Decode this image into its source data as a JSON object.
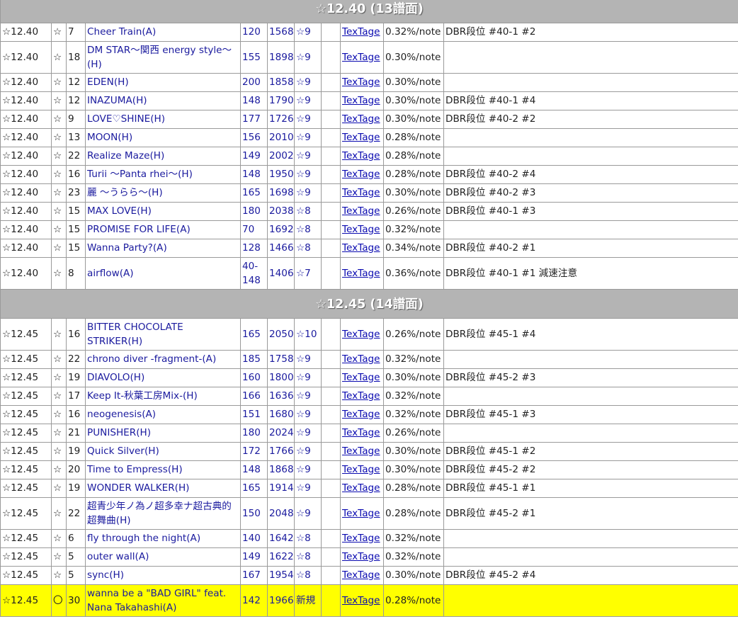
{
  "sections": [
    {
      "header": "☆12.40 (13譜面)",
      "rows": [
        {
          "level": "☆12.40",
          "mark": "☆",
          "ver": "7",
          "title": "Cheer Train(A)",
          "bpm": "120",
          "notes": "1568",
          "sran": "☆9",
          "link": "TexTage",
          "rate": "0.32%/note",
          "note": "DBR段位 #40-1 #2"
        },
        {
          "level": "☆12.40",
          "mark": "☆",
          "ver": "18",
          "title": "DM STAR〜関西 energy style〜(H)",
          "bpm": "155",
          "notes": "1898",
          "sran": "☆9",
          "link": "TexTage",
          "rate": "0.30%/note",
          "note": "",
          "wrap": true
        },
        {
          "level": "☆12.40",
          "mark": "☆",
          "ver": "12",
          "title": "EDEN(H)",
          "bpm": "200",
          "notes": "1858",
          "sran": "☆9",
          "link": "TexTage",
          "rate": "0.30%/note",
          "note": ""
        },
        {
          "level": "☆12.40",
          "mark": "☆",
          "ver": "12",
          "title": "INAZUMA(H)",
          "bpm": "148",
          "notes": "1790",
          "sran": "☆9",
          "link": "TexTage",
          "rate": "0.30%/note",
          "note": "DBR段位 #40-1 #4"
        },
        {
          "level": "☆12.40",
          "mark": "☆",
          "ver": "9",
          "title": "LOVE♡SHINE(H)",
          "bpm": "177",
          "notes": "1726",
          "sran": "☆9",
          "link": "TexTage",
          "rate": "0.30%/note",
          "note": "DBR段位 #40-2 #2"
        },
        {
          "level": "☆12.40",
          "mark": "☆",
          "ver": "13",
          "title": "MOON(H)",
          "bpm": "156",
          "notes": "2010",
          "sran": "☆9",
          "link": "TexTage",
          "rate": "0.28%/note",
          "note": ""
        },
        {
          "level": "☆12.40",
          "mark": "☆",
          "ver": "22",
          "title": "Realize Maze(H)",
          "bpm": "149",
          "notes": "2002",
          "sran": "☆9",
          "link": "TexTage",
          "rate": "0.28%/note",
          "note": ""
        },
        {
          "level": "☆12.40",
          "mark": "☆",
          "ver": "16",
          "title": "Turii 〜Panta rhei〜(H)",
          "bpm": "148",
          "notes": "1950",
          "sran": "☆9",
          "link": "TexTage",
          "rate": "0.28%/note",
          "note": "DBR段位 #40-2 #4"
        },
        {
          "level": "☆12.40",
          "mark": "☆",
          "ver": "23",
          "title": "麗 〜うらら〜(H)",
          "bpm": "165",
          "notes": "1698",
          "sran": "☆9",
          "link": "TexTage",
          "rate": "0.30%/note",
          "note": "DBR段位 #40-2 #3"
        },
        {
          "level": "☆12.40",
          "mark": "☆",
          "ver": "15",
          "title": "MAX LOVE(H)",
          "bpm": "180",
          "notes": "2038",
          "sran": "☆8",
          "link": "TexTage",
          "rate": "0.26%/note",
          "note": "DBR段位 #40-1 #3"
        },
        {
          "level": "☆12.40",
          "mark": "☆",
          "ver": "15",
          "title": "PROMISE FOR LIFE(A)",
          "bpm": "70",
          "notes": "1692",
          "sran": "☆8",
          "link": "TexTage",
          "rate": "0.32%/note",
          "note": ""
        },
        {
          "level": "☆12.40",
          "mark": "☆",
          "ver": "15",
          "title": "Wanna Party?(A)",
          "bpm": "128",
          "notes": "1466",
          "sran": "☆8",
          "link": "TexTage",
          "rate": "0.34%/note",
          "note": "DBR段位 #40-2 #1"
        },
        {
          "level": "☆12.40",
          "mark": "☆",
          "ver": "8",
          "title": "airflow(A)",
          "bpm": "40-148",
          "notes": "1406",
          "sran": "☆7",
          "link": "TexTage",
          "rate": "0.36%/note",
          "note": "DBR段位 #40-1 #1 減速注意",
          "wrap": true
        }
      ]
    },
    {
      "header": "☆12.45 (14譜面)",
      "rows": [
        {
          "level": "☆12.45",
          "mark": "☆",
          "ver": "16",
          "title": "BITTER CHOCOLATE STRIKER(H)",
          "bpm": "165",
          "notes": "2050",
          "sran": "☆10",
          "link": "TexTage",
          "rate": "0.26%/note",
          "note": "DBR段位 #45-1 #4",
          "wrap": true
        },
        {
          "level": "☆12.45",
          "mark": "☆",
          "ver": "22",
          "title": "chrono diver -fragment-(A)",
          "bpm": "185",
          "notes": "1758",
          "sran": "☆9",
          "link": "TexTage",
          "rate": "0.32%/note",
          "note": ""
        },
        {
          "level": "☆12.45",
          "mark": "☆",
          "ver": "19",
          "title": "DIAVOLO(H)",
          "bpm": "160",
          "notes": "1800",
          "sran": "☆9",
          "link": "TexTage",
          "rate": "0.30%/note",
          "note": "DBR段位 #45-2 #3"
        },
        {
          "level": "☆12.45",
          "mark": "☆",
          "ver": "17",
          "title": "Keep It-秋葉工房Mix-(H)",
          "bpm": "166",
          "notes": "1636",
          "sran": "☆9",
          "link": "TexTage",
          "rate": "0.32%/note",
          "note": ""
        },
        {
          "level": "☆12.45",
          "mark": "☆",
          "ver": "16",
          "title": "neogenesis(A)",
          "bpm": "151",
          "notes": "1680",
          "sran": "☆9",
          "link": "TexTage",
          "rate": "0.32%/note",
          "note": "DBR段位 #45-1 #3"
        },
        {
          "level": "☆12.45",
          "mark": "☆",
          "ver": "21",
          "title": "PUNISHER(H)",
          "bpm": "180",
          "notes": "2024",
          "sran": "☆9",
          "link": "TexTage",
          "rate": "0.26%/note",
          "note": ""
        },
        {
          "level": "☆12.45",
          "mark": "☆",
          "ver": "19",
          "title": "Quick Silver(H)",
          "bpm": "172",
          "notes": "1766",
          "sran": "☆9",
          "link": "TexTage",
          "rate": "0.30%/note",
          "note": "DBR段位 #45-1 #2"
        },
        {
          "level": "☆12.45",
          "mark": "☆",
          "ver": "20",
          "title": "Time to Empress(H)",
          "bpm": "148",
          "notes": "1868",
          "sran": "☆9",
          "link": "TexTage",
          "rate": "0.30%/note",
          "note": "DBR段位 #45-2 #2"
        },
        {
          "level": "☆12.45",
          "mark": "☆",
          "ver": "19",
          "title": "WONDER WALKER(H)",
          "bpm": "165",
          "notes": "1914",
          "sran": "☆9",
          "link": "TexTage",
          "rate": "0.28%/note",
          "note": "DBR段位 #45-1 #1"
        },
        {
          "level": "☆12.45",
          "mark": "☆",
          "ver": "22",
          "title": "超青少年ノ為ノ超多幸ナ超古典的超舞曲(H)",
          "bpm": "150",
          "notes": "2048",
          "sran": "☆9",
          "link": "TexTage",
          "rate": "0.28%/note",
          "note": "DBR段位 #45-2 #1",
          "wrap": true
        },
        {
          "level": "☆12.45",
          "mark": "☆",
          "ver": "6",
          "title": "fly through the night(A)",
          "bpm": "140",
          "notes": "1642",
          "sran": "☆8",
          "link": "TexTage",
          "rate": "0.32%/note",
          "note": ""
        },
        {
          "level": "☆12.45",
          "mark": "☆",
          "ver": "5",
          "title": "outer wall(A)",
          "bpm": "149",
          "notes": "1622",
          "sran": "☆8",
          "link": "TexTage",
          "rate": "0.32%/note",
          "note": ""
        },
        {
          "level": "☆12.45",
          "mark": "☆",
          "ver": "5",
          "title": "sync(H)",
          "bpm": "167",
          "notes": "1954",
          "sran": "☆8",
          "link": "TexTage",
          "rate": "0.30%/note",
          "note": "DBR段位 #45-2 #4"
        },
        {
          "level": "☆12.45",
          "mark": "〇",
          "ver": "30",
          "title": "wanna be a \"BAD GIRL\" feat. Nana Takahashi(A)",
          "bpm": "142",
          "notes": "1966",
          "sran": "新規",
          "link": "TexTage",
          "rate": "0.28%/note",
          "note": "",
          "wrap": true,
          "highlight": true,
          "highlight_color": "#ffff00"
        }
      ]
    }
  ]
}
